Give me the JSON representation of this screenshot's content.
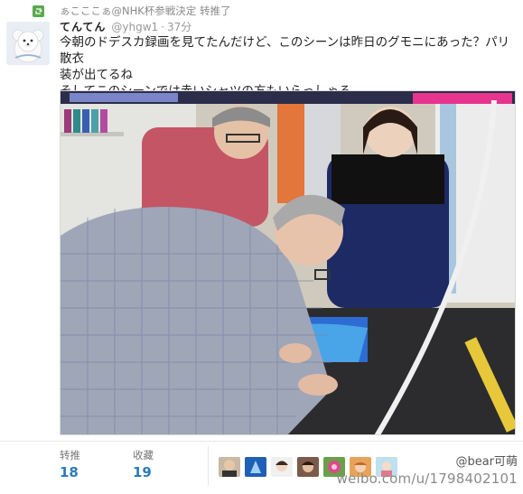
{
  "retweet": {
    "text": "ぁこここぁ@NHK杯参戦決定 转推了",
    "color": "#5aa94c"
  },
  "author": {
    "display_name": "てんてん",
    "handle": "@yhgw1",
    "separator": "·",
    "time": "37分"
  },
  "tweet": {
    "lines": [
      "今朝のドデスカ録画を見てたんだけど、このシーンは昨日のグモニにあった？パリ散衣",
      "装が出てるね",
      "そしてこのシーンでは赤いシャツの方もいらっしゃる"
    ]
  },
  "photo": {
    "description_icon": "tv-screenshot-image"
  },
  "stats": {
    "retweets": {
      "label": "转推",
      "value": "18"
    },
    "favorites": {
      "label": "收藏",
      "value": "19"
    }
  },
  "favoriters_count": 8,
  "watermark": {
    "handle": "@bear可萌",
    "url": "weibo.com/u/1798402101"
  },
  "colors": {
    "accent": "#2b7bb9",
    "muted": "#999999"
  }
}
